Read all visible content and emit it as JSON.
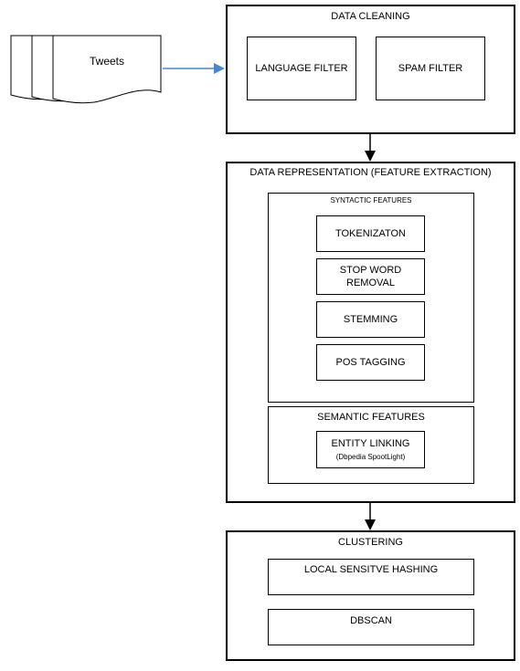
{
  "input": {
    "label": "Tweets"
  },
  "data_cleaning": {
    "title": "DATA CLEANING",
    "steps": [
      "LANGUAGE FILTER",
      "SPAM FILTER"
    ]
  },
  "data_representation": {
    "title": "DATA REPRESENTATION (FEATURE EXTRACTION)",
    "syntactic": {
      "title": "SYNTACTIC FEATURES",
      "steps": [
        "TOKENIZATON",
        "STOP WORD REMOVAL",
        "STEMMING",
        "POS TAGGING"
      ]
    },
    "semantic": {
      "title": "SEMANTIC FEATURES",
      "entity_linking": "ENTITY LINKING",
      "entity_linking_sub": "(Dbpedia SpootLight)"
    }
  },
  "clustering": {
    "title": "CLUSTERING",
    "steps": [
      "LOCAL SENSITVE HASHING",
      "DBSCAN"
    ]
  },
  "colors": {
    "input_arrow": "#4a86c8",
    "dashed_connector": "#a6a6a6",
    "stroke": "#000000"
  }
}
